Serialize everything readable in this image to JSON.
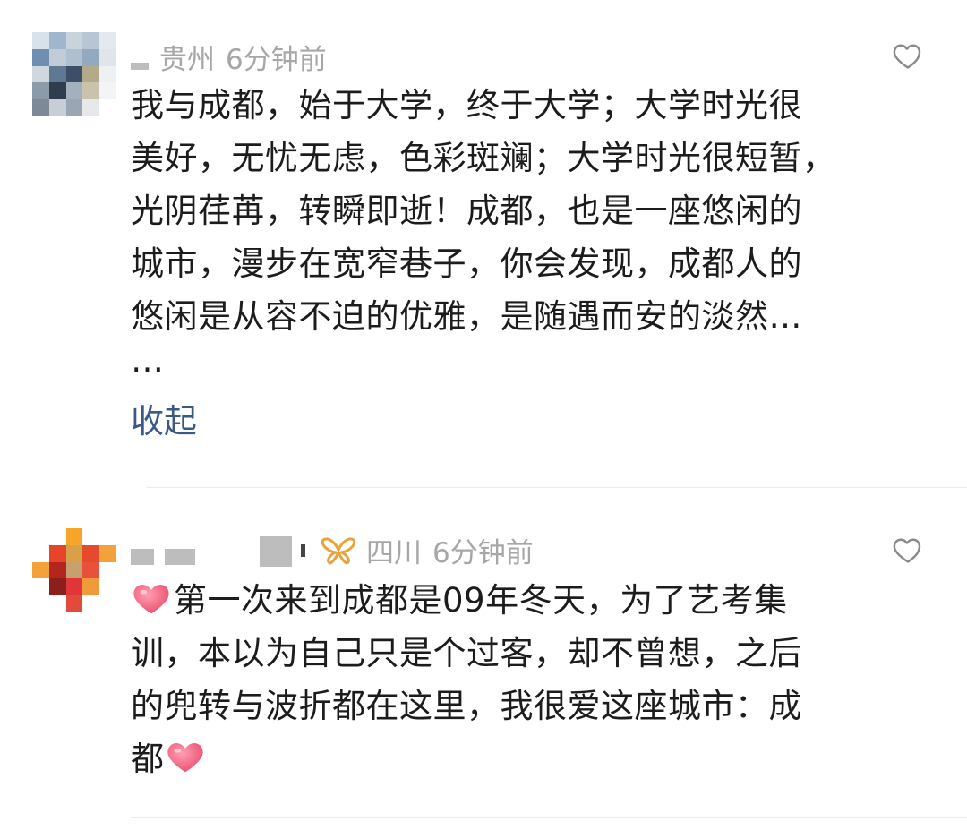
{
  "comments": [
    {
      "region": "贵州",
      "time": "6分钟前",
      "content_lines": [
        "我与成都，始于大学，终于大学；大学时光很",
        "美好，无忧无虑，色彩斑斓；大学时光很短暂，",
        "光阴荏苒，转瞬即逝！成都，也是一座悠闲的",
        "城市，漫步在宽窄巷子，你会发现，成都人的",
        "悠闲是从容不迫的优雅，是随遇而安的淡然…",
        "…"
      ],
      "collapse_label": "收起",
      "like_icon": "heart-outline-icon"
    },
    {
      "region": "四川",
      "time": "6分钟前",
      "badge_icon": "orange-ribbon-badge-icon",
      "content_lines": [
        "第一次来到成都是09年冬天，为了艺考集",
        "训，本以为自己只是个过客，却不曾想，之后",
        "的兜转与波折都在这里，我很爱这座城市：成",
        "都"
      ],
      "leading_emoji": "pink-heart-emoji",
      "trailing_emoji": "pink-heart-emoji",
      "like_icon": "heart-outline-icon"
    }
  ],
  "colors": {
    "meta_text": "#a7a7a7",
    "content_text": "#1c1c1c",
    "link": "#3a5a86",
    "divider": "#ececec",
    "heart_emoji": "#f2607c"
  }
}
